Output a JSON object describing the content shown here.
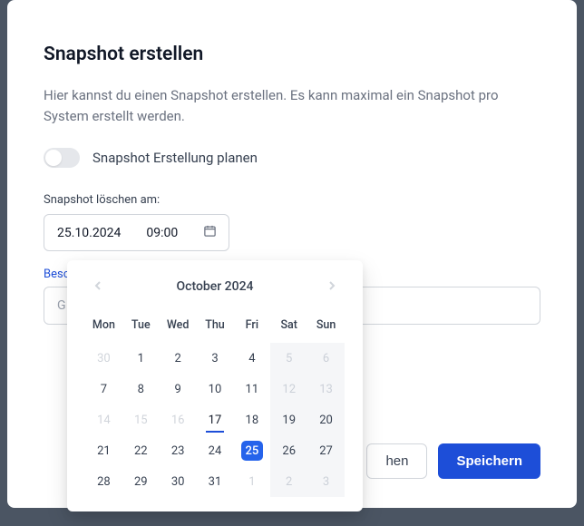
{
  "title": "Snapshot erstellen",
  "description": "Hier kannst du einen Snapshot erstellen. Es kann maximal ein Snapshot pro System erstellt werden.",
  "toggle": {
    "label": "Snapshot Erstellung planen",
    "on": false
  },
  "delete_field": {
    "label": "Snapshot löschen am:",
    "date": "25.10.2024",
    "time": "09:00"
  },
  "desc_field": {
    "label": "Besc",
    "value_prefix": "G"
  },
  "buttons": {
    "cancel_visible": "hen",
    "save": "Speichern"
  },
  "datepicker": {
    "month_label": "October 2024",
    "dows": [
      "Mon",
      "Tue",
      "Wed",
      "Thu",
      "Fri",
      "Sat",
      "Sun"
    ],
    "weeks": [
      [
        {
          "n": "30",
          "muted": true
        },
        {
          "n": "1"
        },
        {
          "n": "2"
        },
        {
          "n": "3"
        },
        {
          "n": "4"
        },
        {
          "n": "5",
          "wkmuted": true
        },
        {
          "n": "6",
          "wkmuted": true
        }
      ],
      [
        {
          "n": "7"
        },
        {
          "n": "8"
        },
        {
          "n": "9"
        },
        {
          "n": "10"
        },
        {
          "n": "11"
        },
        {
          "n": "12",
          "wkmuted": true
        },
        {
          "n": "13",
          "wkmuted": true
        }
      ],
      [
        {
          "n": "14",
          "muted": true
        },
        {
          "n": "15",
          "muted": true
        },
        {
          "n": "16",
          "muted": true
        },
        {
          "n": "17",
          "today": true
        },
        {
          "n": "18"
        },
        {
          "n": "19",
          "wk": true
        },
        {
          "n": "20",
          "wk": true
        }
      ],
      [
        {
          "n": "21"
        },
        {
          "n": "22"
        },
        {
          "n": "23"
        },
        {
          "n": "24"
        },
        {
          "n": "25",
          "selected": true
        },
        {
          "n": "26",
          "wk": true
        },
        {
          "n": "27",
          "wk": true
        }
      ],
      [
        {
          "n": "28"
        },
        {
          "n": "29"
        },
        {
          "n": "30"
        },
        {
          "n": "31"
        },
        {
          "n": "1",
          "muted": true
        },
        {
          "n": "2",
          "wkmuted": true
        },
        {
          "n": "3",
          "wkmuted": true
        }
      ]
    ]
  }
}
